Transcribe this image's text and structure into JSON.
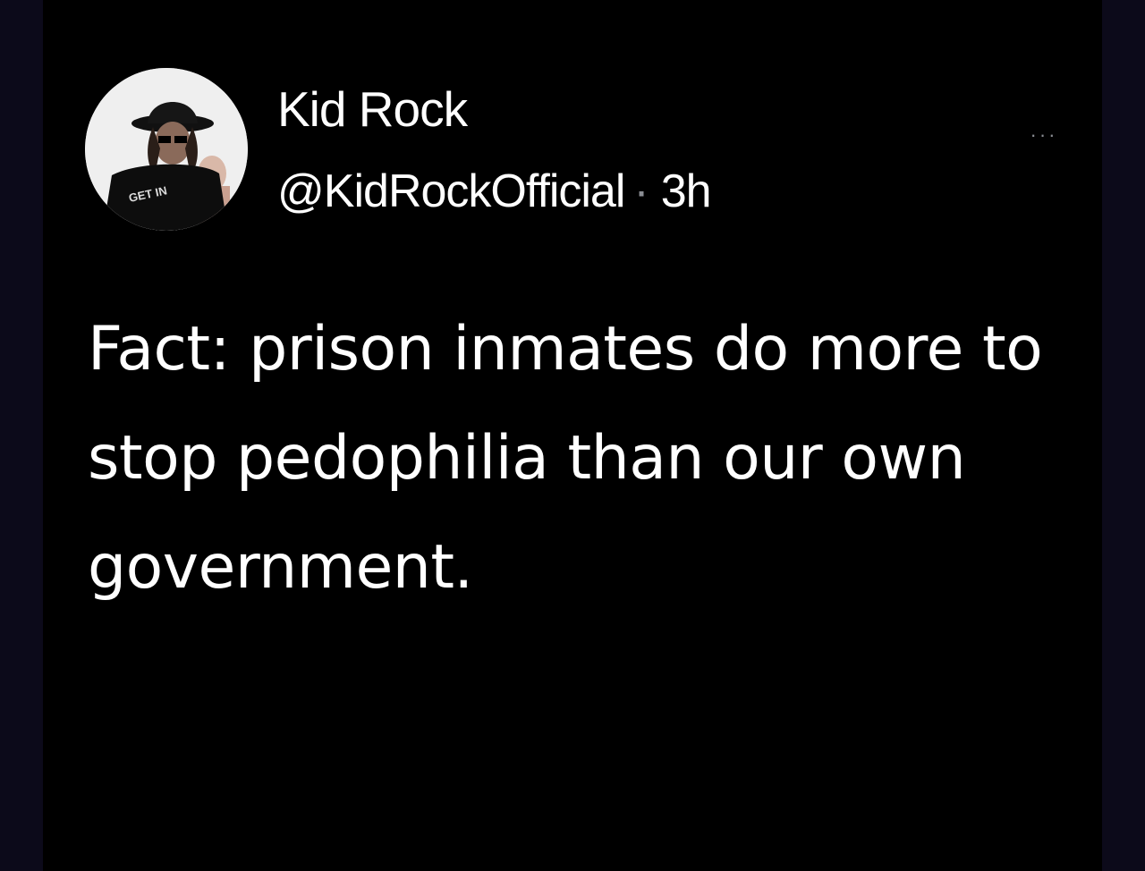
{
  "tweet": {
    "display_name": "Kid Rock",
    "handle": "@KidRockOfficial",
    "separator": "·",
    "time": "3h",
    "more_label": "···",
    "text": "Fact: prison inmates do more to stop pedophilia than our own government.",
    "avatar": {
      "icon": "profile-photo-icon",
      "shirt_text": "GET IN"
    }
  },
  "colors": {
    "background": "#000000",
    "outer_background": "#0c0a1a",
    "text_primary": "#ffffff",
    "text_secondary": "#8a8d93"
  }
}
